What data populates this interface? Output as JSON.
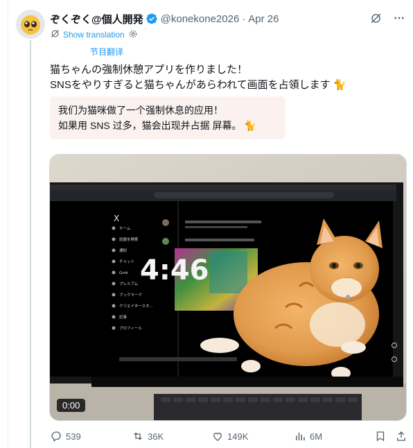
{
  "author": {
    "name": "ぞくぞく@個人開発",
    "handle": "@konekone2026",
    "separator": "·",
    "date": "Apr 26"
  },
  "translation": {
    "show_label": "Show translation",
    "cn_label": "节目翻译"
  },
  "tweet": {
    "line1": "猫ちゃんの強制休憩アプリを作りました！",
    "line2": "SNSをやりすぎると猫ちゃんがあらわれて画面を占領します 🐈",
    "translated_line1": "我们为猫咪做了一个强制休息的应用！",
    "translated_line2": "如果用 SNS 过多，猫会出现并占据 屏幕。 🐈"
  },
  "media": {
    "clock": "4:46",
    "timecode": "0:00",
    "screen_menu": [
      "ホーム",
      "話題を検索",
      "通知",
      "チャット",
      "Grok",
      "プレミアム",
      "ブックマーク",
      "クリエイタースタ...",
      "記事",
      "プロフィール"
    ]
  },
  "actions": {
    "replies": "539",
    "reposts": "36K",
    "likes": "149K",
    "views": "6M"
  },
  "colors": {
    "accent": "#1d9bf0",
    "muted": "#536471",
    "translation_bg": "#fbf2f0"
  }
}
